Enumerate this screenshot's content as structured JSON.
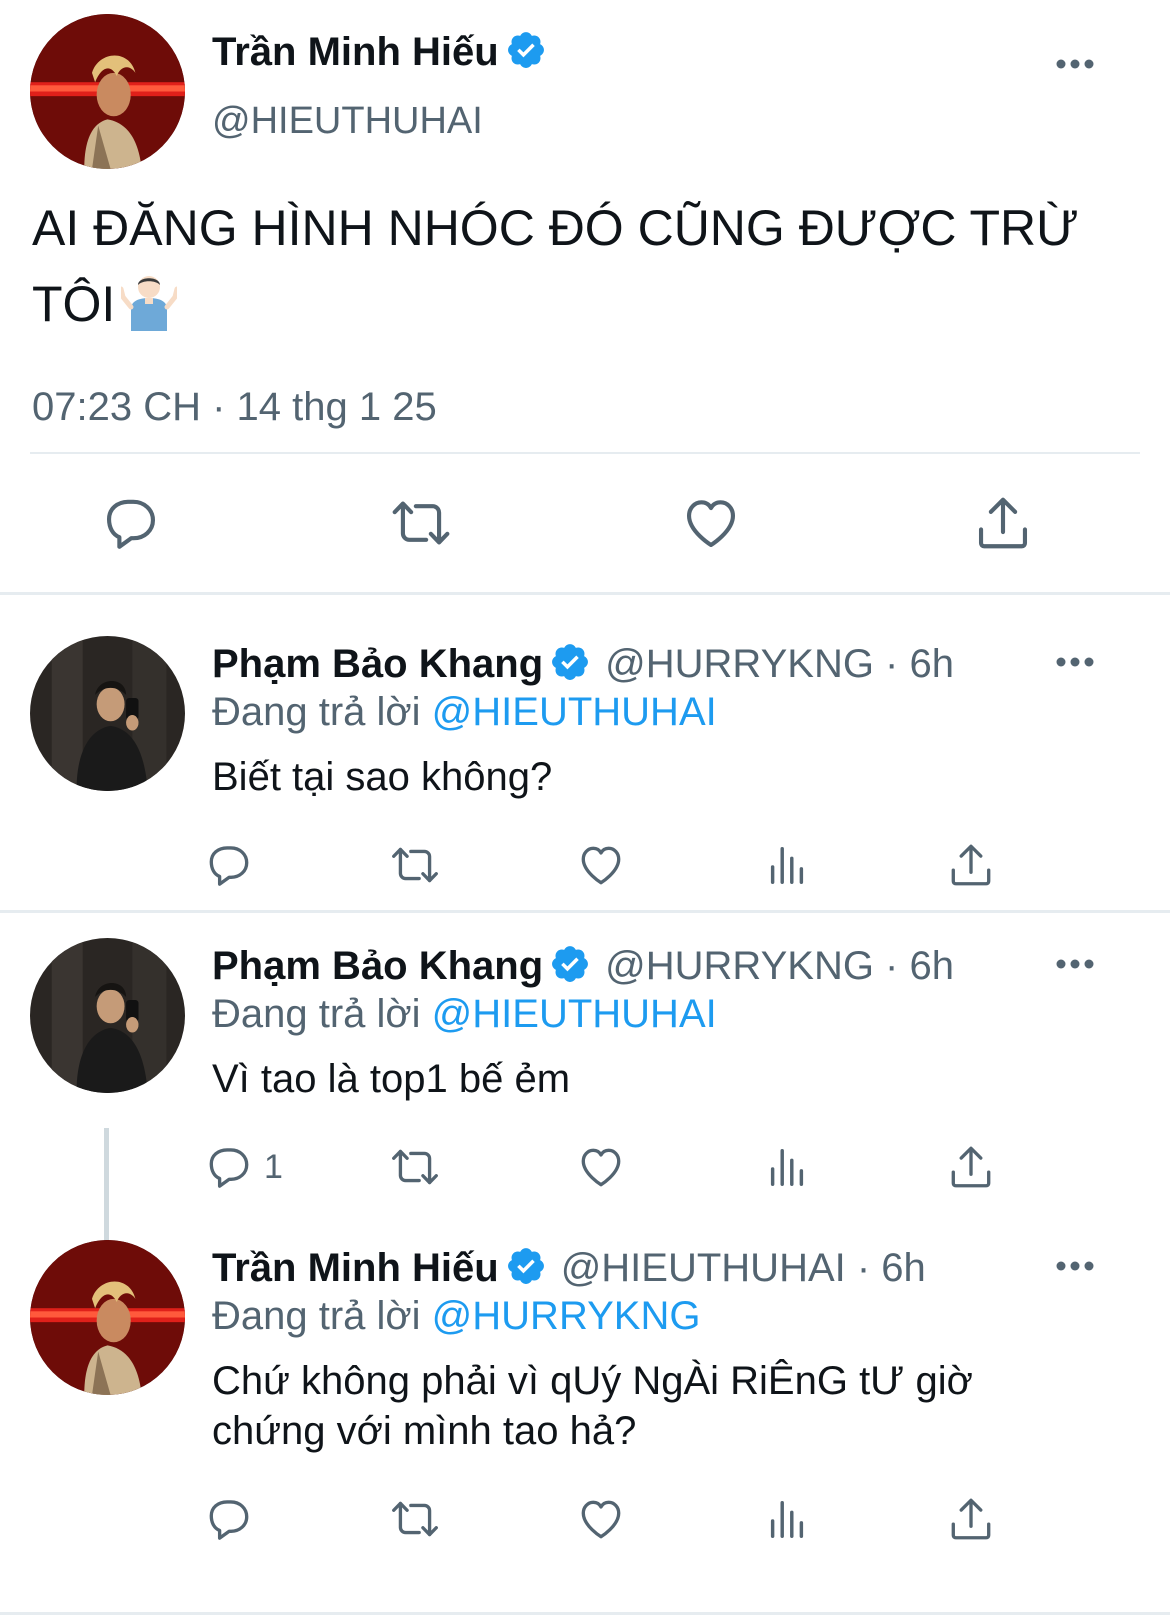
{
  "colors": {
    "accent": "#1d9bf0",
    "muted": "#536471",
    "text": "#0f1419",
    "divider": "#e6ecf0"
  },
  "main_tweet": {
    "name": "Trần Minh Hiếu",
    "handle": "@HIEUTHUHAI",
    "text_line1": "AI ĐĂNG HÌNH NHÓC ĐÓ CŨNG ĐƯỢC TRỪ",
    "text_line2": "TÔI",
    "emoji": "person-shrugging",
    "timestamp": "07:23 CH · 14 thg 1 25",
    "actions": [
      "reply-icon",
      "retweet-icon",
      "like-icon",
      "share-icon"
    ]
  },
  "replies": [
    {
      "name": "Phạm Bảo Khang",
      "handle_time": "@HURRYKNG · 6h",
      "replying_prefix": "Đang trả lời",
      "replying_to": "@HIEUTHUHAI",
      "text": "Biết tại sao không?",
      "reply_count": ""
    },
    {
      "name": "Phạm Bảo Khang",
      "handle_time": "@HURRYKNG · 6h",
      "replying_prefix": "Đang trả lời",
      "replying_to": "@HIEUTHUHAI",
      "text": "Vì tao là top1 bế ẻm",
      "reply_count": "1"
    },
    {
      "name": "Trần Minh Hiếu",
      "handle_time": "@HIEUTHUHAI · 6h",
      "replying_prefix": "Đang trả lời",
      "replying_to": "@HURRYKNG",
      "text_line1": "Chứ không phải vì qUý NgÀi RiÊnG tƯ giờ",
      "text_line2": "chứng với mình tao hả?",
      "reply_count": ""
    }
  ]
}
